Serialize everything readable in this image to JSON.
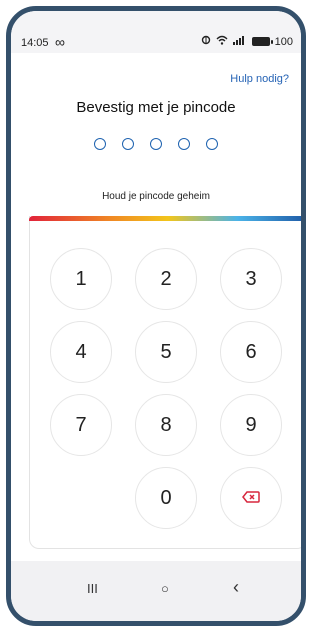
{
  "status_bar": {
    "time": "14:05",
    "infinity_icon": "∞",
    "battery": "100"
  },
  "header": {
    "help_link": "Hulp nodig?"
  },
  "pin": {
    "title": "Bevestig met je pincode",
    "digits_total": 5,
    "digits_filled": 0,
    "hint": "Houd je pincode geheim"
  },
  "keypad": {
    "keys": [
      "1",
      "2",
      "3",
      "4",
      "5",
      "6",
      "7",
      "8",
      "9",
      "0"
    ],
    "backspace_icon": "backspace-icon"
  },
  "navigation": {
    "recent": "III",
    "home": "○",
    "back": "‹"
  },
  "colors": {
    "accent": "#1f63b0",
    "link": "#2563b5",
    "backspace": "#d7263d"
  }
}
